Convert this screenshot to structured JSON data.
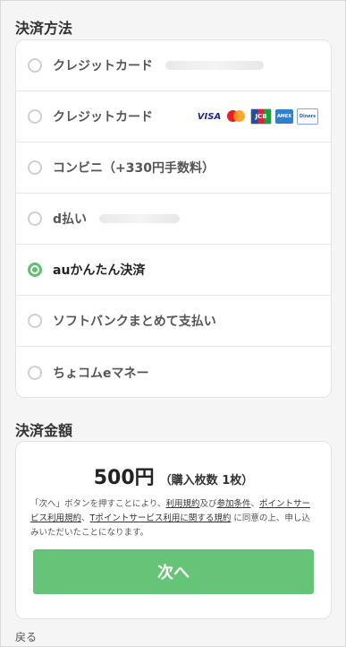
{
  "payment_method": {
    "title": "決済方法",
    "options": [
      {
        "label": "クレジットカード",
        "selected": false
      },
      {
        "label": "クレジットカード",
        "selected": false,
        "card_logos": [
          "VISA",
          "Mastercard",
          "JCB",
          "AMERICAN EXPRESS",
          "Diners Club"
        ]
      },
      {
        "label": "コンビニ（+330円手数料）",
        "selected": false
      },
      {
        "label": "d払い",
        "selected": false
      },
      {
        "label": "auかんたん決済",
        "selected": true
      },
      {
        "label": "ソフトバンクまとめて支払い",
        "selected": false
      },
      {
        "label": "ちょコムeマネー",
        "selected": false
      }
    ]
  },
  "payment_amount": {
    "title": "決済金額",
    "price": "500円",
    "quantity": "（購入枚数 1枚）",
    "terms": {
      "t1": "「次へ」ボタンを押すことにより、",
      "link1": "利用規約",
      "t2": "及び",
      "link2": "参加条件",
      "t3": "、",
      "link3": "ポイントサービス利用規約",
      "t4": "、",
      "link4": "Tポイントサービス利用に関する規約",
      "t5": " に同意の上、申し込みいただいたことになります。"
    },
    "next_label": "次へ"
  },
  "back_label": "戻る",
  "colors": {
    "accent": "#5ec16f",
    "button": "#66c478"
  }
}
